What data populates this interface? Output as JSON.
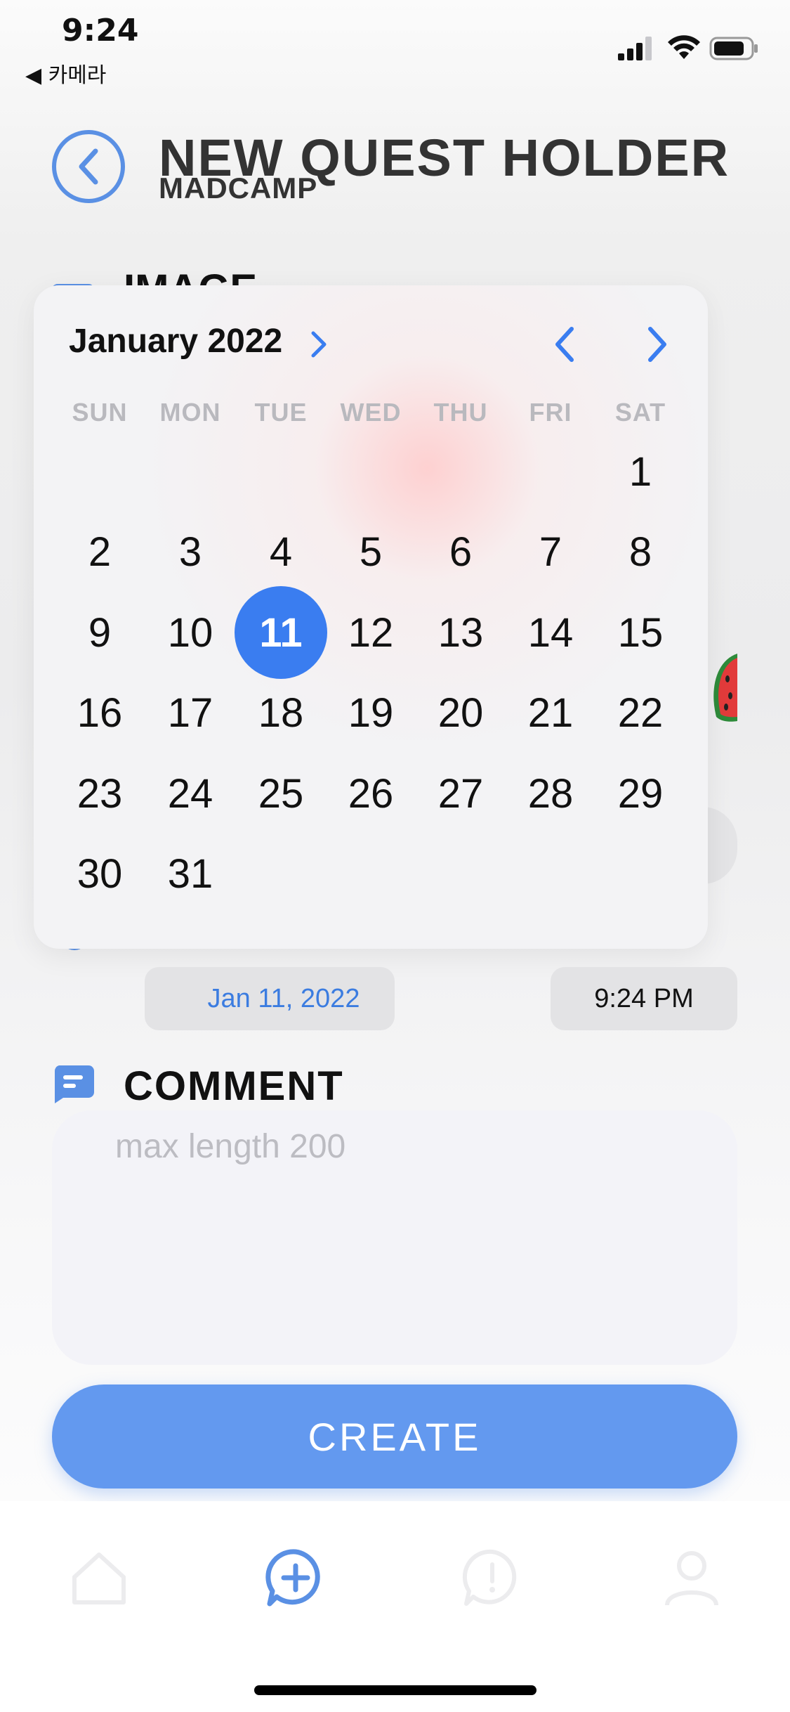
{
  "status_bar": {
    "time": "9:24",
    "back_app": "◀ 카메라"
  },
  "header": {
    "title": "NEW QUEST HOLDER",
    "subtitle": "MADCAMP"
  },
  "sections": {
    "image_label": "IMAGE",
    "comment_label": "COMMENT"
  },
  "calendar": {
    "month_label": "January 2022",
    "weekdays": [
      "SUN",
      "MON",
      "TUE",
      "WED",
      "THU",
      "FRI",
      "SAT"
    ],
    "first_weekday_index": 6,
    "days_in_month": 31,
    "selected_day": 11,
    "accent_color": "#3a7df0"
  },
  "datetime": {
    "date_value": "Jan 11, 2022",
    "time_value": "9:24 PM"
  },
  "comment": {
    "placeholder": "max length 200",
    "value": ""
  },
  "actions": {
    "create_label": "CREATE"
  },
  "tabbar": {
    "items": [
      "home-icon",
      "add-quest-icon",
      "chat-icon",
      "profile-icon"
    ],
    "active_index": 1
  },
  "colors": {
    "primary": "#5a90e4",
    "button": "#6399ef",
    "date_text": "#3b7ce0"
  }
}
